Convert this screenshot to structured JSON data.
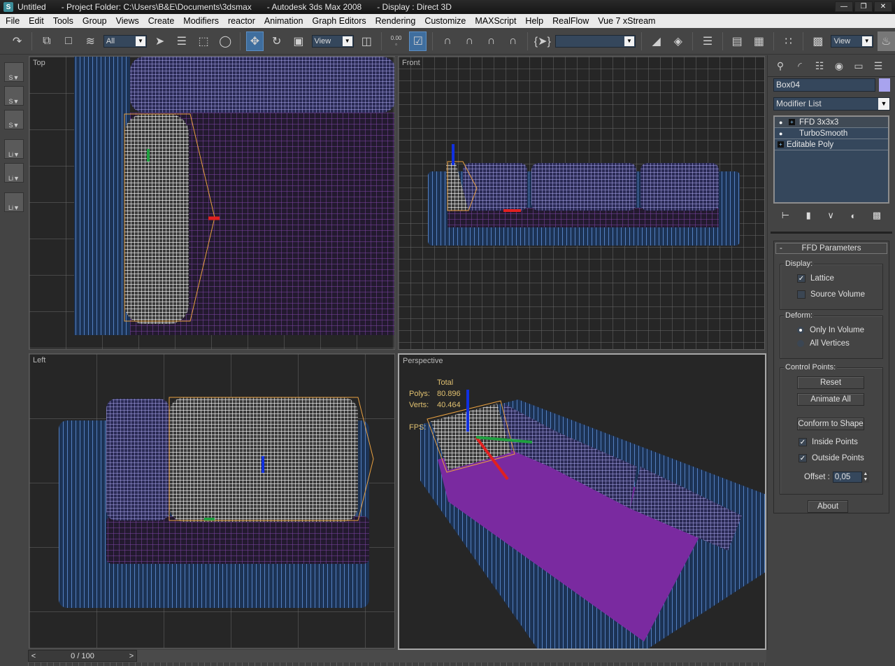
{
  "titlebar": {
    "doc": "Untitled",
    "project": "- Project Folder: C:\\Users\\B&E\\Documents\\3dsmax",
    "app": "- Autodesk 3ds Max 2008",
    "display": "- Display : Direct 3D",
    "app_icon": "S",
    "buttons": [
      "minimize",
      "restore",
      "close"
    ]
  },
  "menu": [
    "File",
    "Edit",
    "Tools",
    "Group",
    "Views",
    "Create",
    "Modifiers",
    "reactor",
    "Animation",
    "Graph Editors",
    "Rendering",
    "Customize",
    "MAXScript",
    "Help",
    "RealFlow",
    "Vue 7 xStream"
  ],
  "toolbar": {
    "selection_filter": "All",
    "ref_coord": "View",
    "named_selection": "",
    "render_view": "View",
    "spinner_snap": "0.00"
  },
  "viewports": {
    "top": {
      "label": "Top"
    },
    "front": {
      "label": "Front"
    },
    "left": {
      "label": "Left"
    },
    "perspective": {
      "label": "Perspective",
      "stats_header": "Total",
      "polys_label": "Polys:",
      "polys": "80.896",
      "verts_label": "Verts:",
      "verts": "40.464",
      "fps_label": "FPS:"
    }
  },
  "colors": {
    "sofa_base": "#5b93e0",
    "sofa_cushion": "#a8a3ee",
    "seat": "#7a2aa0",
    "selected": "#ffffff",
    "lattice": "#e8a040",
    "active_tool": "#3f6e9e",
    "field_bg": "#35475c"
  },
  "command_panel": {
    "object_name": "Box04",
    "object_color": "#a8a3ee",
    "modifier_list": "Modifier List",
    "stack": [
      {
        "label": "FFD 3x3x3",
        "bulb": true,
        "expand": true
      },
      {
        "label": "TurboSmooth",
        "bulb": true,
        "expand": false
      },
      {
        "label": "Editable Poly",
        "bulb": false,
        "expand": true
      }
    ],
    "rollout_title": "FFD Parameters",
    "display_group": "Display:",
    "lattice": {
      "label": "Lattice",
      "checked": true
    },
    "source_volume": {
      "label": "Source Volume",
      "checked": false
    },
    "deform_group": "Deform:",
    "only_in_volume": {
      "label": "Only In Volume",
      "selected": true
    },
    "all_vertices": {
      "label": "All Vertices",
      "selected": false
    },
    "control_points_group": "Control Points:",
    "reset": "Reset",
    "animate_all": "Animate All",
    "conform": "Conform to Shape",
    "inside_points": {
      "label": "Inside Points",
      "checked": true
    },
    "outside_points": {
      "label": "Outside Points",
      "checked": true
    },
    "offset_label": "Offset :",
    "offset_value": "0,05",
    "about": "About"
  },
  "timeline": {
    "frame": "0 / 100",
    "prev": "<",
    "next": ">"
  }
}
